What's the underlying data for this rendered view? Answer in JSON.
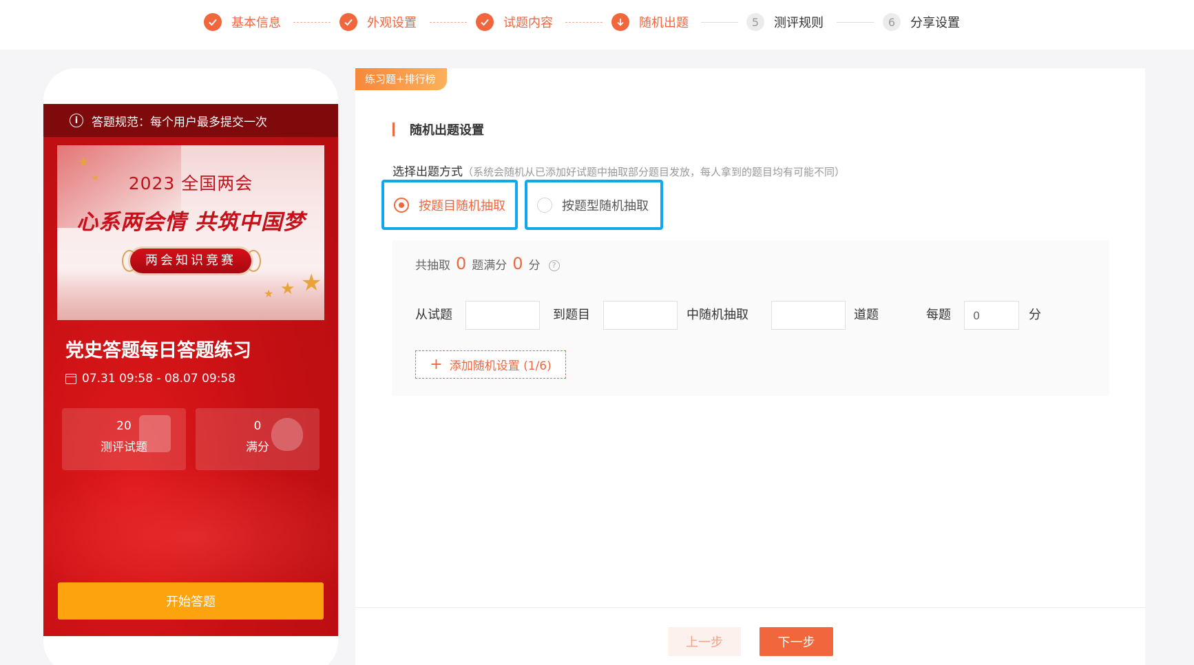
{
  "stepper": {
    "steps": [
      {
        "label": "基本信息",
        "state": "done",
        "icon": "check-icon"
      },
      {
        "label": "外观设置",
        "state": "done",
        "icon": "check-icon"
      },
      {
        "label": "试题内容",
        "state": "done",
        "icon": "check-icon"
      },
      {
        "label": "随机出题",
        "state": "current",
        "icon": "arrow-down-icon"
      },
      {
        "label": "测评规则",
        "state": "todo",
        "number": "5"
      },
      {
        "label": "分享设置",
        "state": "todo",
        "number": "6"
      }
    ]
  },
  "preview": {
    "rule_text": "答题规范：每个用户最多提交一次",
    "banner": {
      "year_text": "2023 全国两会",
      "slogan": "心系两会情 共筑中国梦",
      "pill": "两会知识竞赛"
    },
    "quiz_title": "党史答题每日答题练习",
    "date_range": "07.31 09:58 - 08.07 09:58",
    "stats": [
      {
        "value": "20",
        "caption": "测评试题"
      },
      {
        "value": "0",
        "caption": "满分"
      }
    ],
    "start_button": "开始答题"
  },
  "panel": {
    "tag": "练习题+排行榜",
    "section_title": "随机出题设置",
    "method_label": "选择出题方式",
    "method_hint": "（系统会随机从已添加好试题中抽取部分题目发放，每人拿到的题目均有可能不同）",
    "methods": [
      {
        "label": "按题目随机抽取",
        "selected": true
      },
      {
        "label": "按题型随机抽取",
        "selected": false
      }
    ],
    "summary": {
      "prefix": "共抽取",
      "question_count": "0",
      "middle": "题满分",
      "score": "0",
      "suffix": "分",
      "help_icon": "question-circle-icon"
    },
    "range_row": {
      "from_label": "从试题",
      "from_value": "",
      "to_label": "到题目",
      "to_value": "",
      "pick_label": "中随机抽取",
      "pick_value": "",
      "unit_label": "道题",
      "per_label": "每题",
      "per_value": "0",
      "per_unit": "分"
    },
    "add_button": "添加随机设置 (1/6)",
    "prev_button": "上一步",
    "next_button": "下一步"
  },
  "colors": {
    "accent": "#f2663d",
    "highlight_border": "#10a7ef",
    "start_button": "#fca30e",
    "phone_red": "#c71014"
  }
}
